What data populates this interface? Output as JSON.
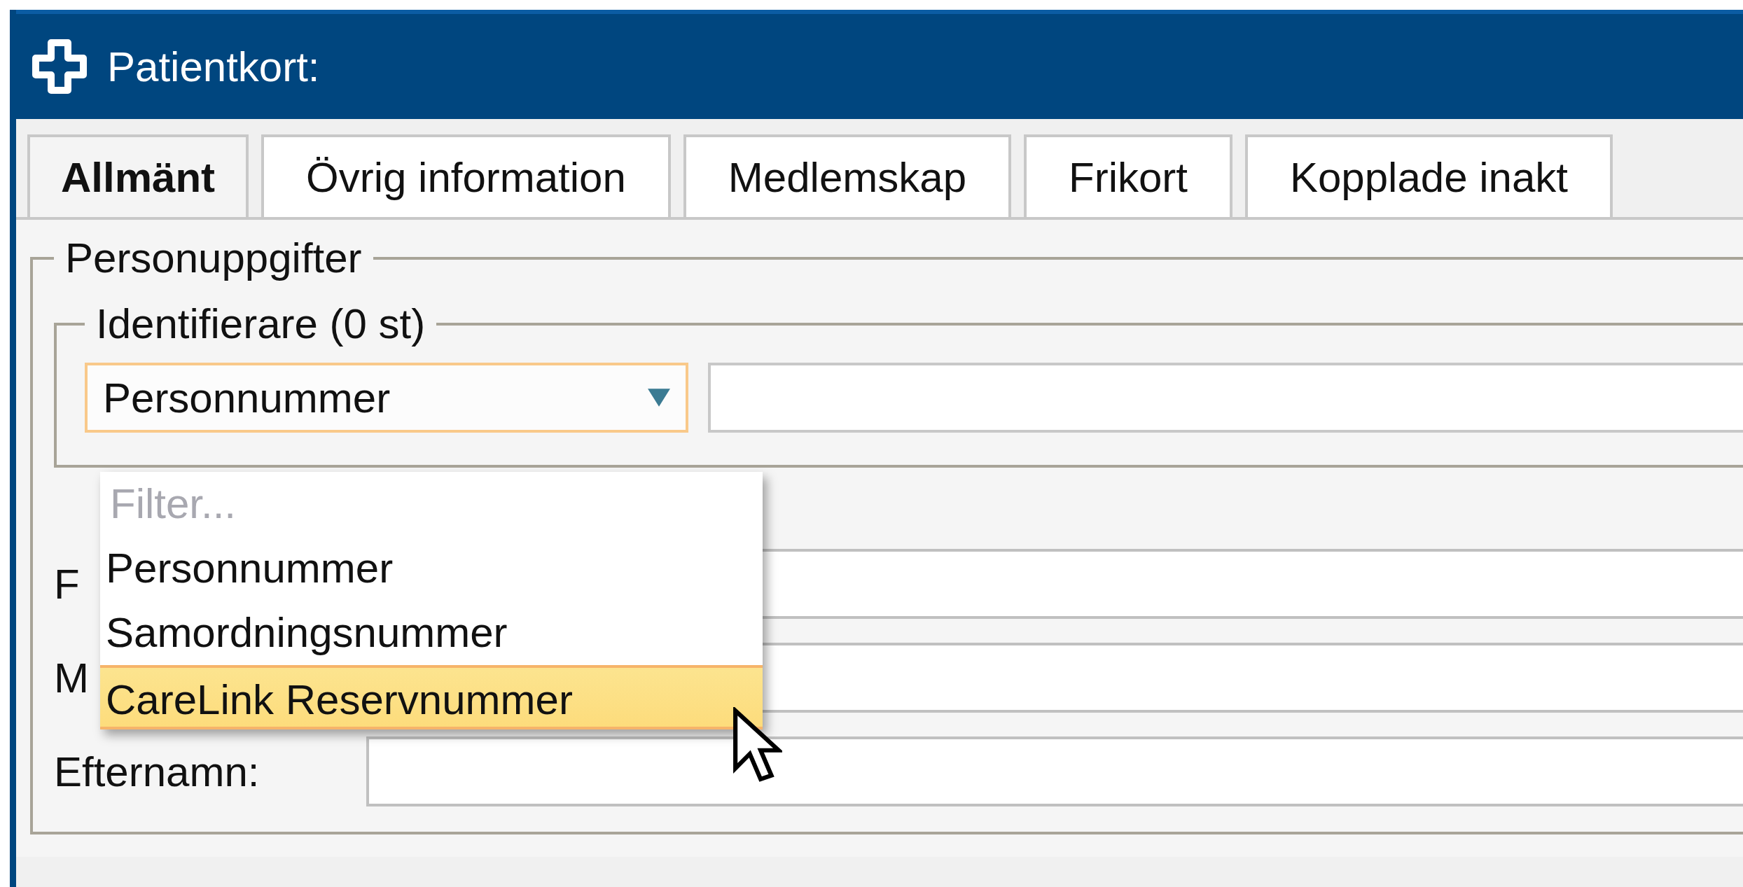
{
  "window": {
    "title": "Patientkort:"
  },
  "tabs": [
    {
      "label": "Allmänt",
      "selected": true
    },
    {
      "label": "Övrig information",
      "selected": false
    },
    {
      "label": "Medlemskap",
      "selected": false
    },
    {
      "label": "Frikort",
      "selected": false
    },
    {
      "label": "Kopplade inakt",
      "selected": false
    }
  ],
  "person_group": {
    "legend": "Personuppgifter",
    "identifiers": {
      "legend": "Identifierare (0 st)",
      "type_select": {
        "value": "Personnummer",
        "expanded": true
      }
    },
    "fields": [
      {
        "label": "F"
      },
      {
        "label": "M"
      },
      {
        "label": "Efternamn:"
      }
    ]
  },
  "dropdown": {
    "filter_placeholder": "Filter...",
    "options": [
      {
        "label": "Personnummer",
        "selected": false
      },
      {
        "label": "Samordningsnummer",
        "selected": false
      },
      {
        "label": "CareLink Reservnummer",
        "selected": true
      }
    ]
  }
}
